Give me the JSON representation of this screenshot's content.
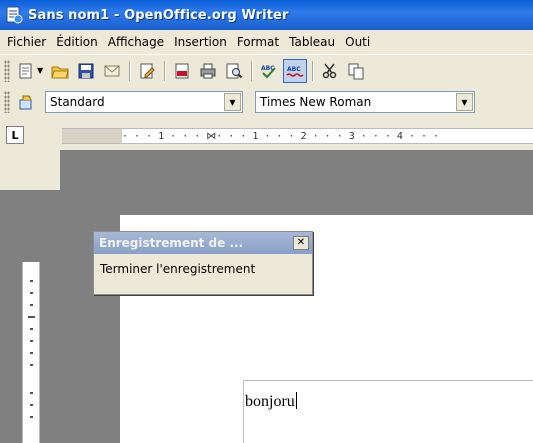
{
  "window": {
    "title": "Sans nom1 - OpenOffice.org Writer"
  },
  "menubar": {
    "items": [
      {
        "label": "Fichier"
      },
      {
        "label": "Édition"
      },
      {
        "label": "Affichage"
      },
      {
        "label": "Insertion"
      },
      {
        "label": "Format"
      },
      {
        "label": "Tableau"
      },
      {
        "label": "Outi"
      }
    ]
  },
  "formatting": {
    "style_value": "Standard",
    "font_value": "Times New Roman"
  },
  "ruler": {
    "tab_stop_symbol": "L",
    "marks": "· · · 1 · · · ⋈· · · 1 · · · 2 · · · 3 · · · 4 · · ·"
  },
  "document": {
    "text": "bonjoru"
  },
  "record_macro": {
    "title": "Enregistrement de ...",
    "action_label": "Terminer l'enregistrement",
    "close_symbol": "✕"
  },
  "icons": {
    "app": "openoffice-writer-icon",
    "toolbar1": [
      "new-document-icon",
      "open-folder-icon",
      "save-icon",
      "email-icon",
      "edit-file-icon",
      "export-pdf-icon",
      "print-icon",
      "page-preview-icon",
      "spellcheck-icon",
      "autospellcheck-icon",
      "cut-icon",
      "copy-icon"
    ],
    "toolbar2": [
      "styles-formatting-icon"
    ]
  },
  "colors": {
    "titlebar": "#0a5fd8",
    "chrome": "#ece9d8",
    "float_title": "#8aa0c8"
  }
}
